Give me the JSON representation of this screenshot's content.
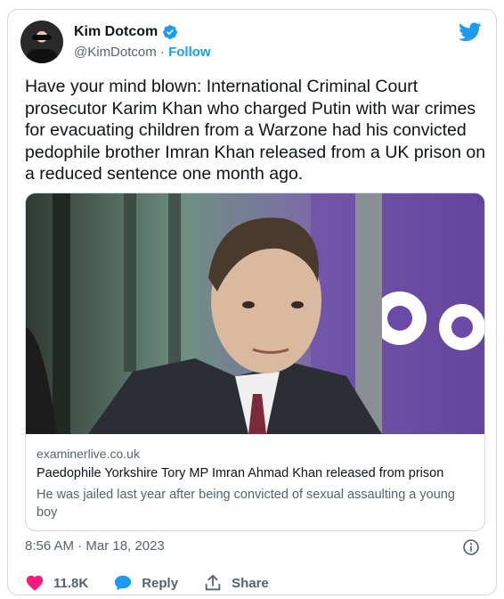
{
  "tweet": {
    "author": {
      "display_name": "Kim Dotcom",
      "handle": "@KimDotcom",
      "separator": " · ",
      "follow_label": "Follow"
    },
    "text": "Have your mind blown: International Criminal Court prosecutor Karim Khan who charged Putin with war crimes for evacuating children from a Warzone had his convicted pedophile brother Imran Khan released from a UK prison on a reduced sentence one month ago.",
    "link_card": {
      "domain": "examinerlive.co.uk",
      "title": "Paedophile Yorkshire Tory MP Imran Ahmad Khan released from prison",
      "description": "He was jailed last year after being convicted of sexual assaulting a young boy"
    },
    "timestamp": "8:56 AM · Mar 18, 2023",
    "actions": {
      "like_count": "11.8K",
      "reply_label": "Reply",
      "share_label": "Share"
    }
  },
  "colors": {
    "accent": "#1d9bf0",
    "like": "#f91880",
    "muted_text": "#536471",
    "border": "#cfd9de"
  },
  "icons": [
    "verified-badge-icon",
    "twitter-bird-icon",
    "info-icon",
    "heart-icon",
    "reply-bubble-icon",
    "share-icon"
  ]
}
